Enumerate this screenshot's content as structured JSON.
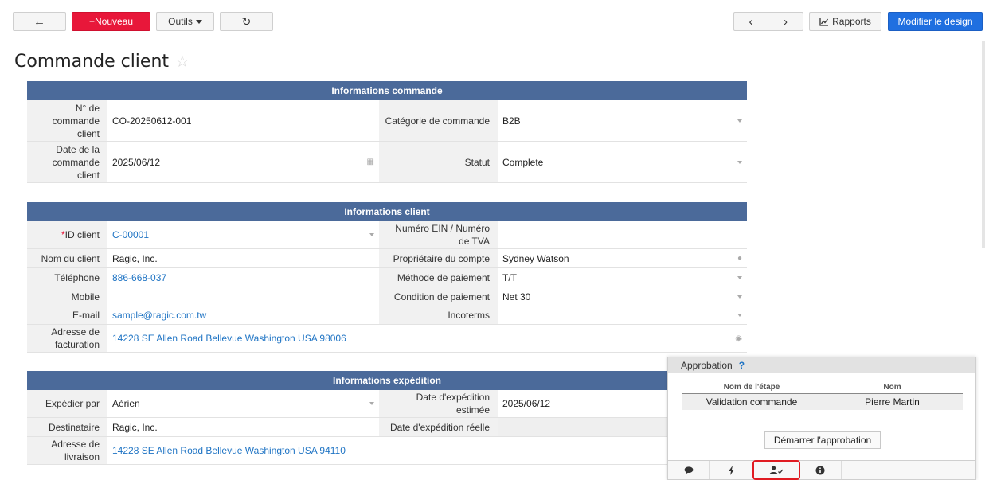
{
  "toolbar": {
    "back_icon": "arrow-left-icon",
    "new_label": "+Nouveau",
    "tools_label": "Outils",
    "refresh_icon": "refresh-icon",
    "prev_icon": "chevron-left-icon",
    "next_icon": "chevron-right-icon",
    "reports_label": "Rapports",
    "design_label": "Modifier le design"
  },
  "page": {
    "title": "Commande client"
  },
  "order": {
    "header": "Informations commande",
    "order_no_label": "N° de commande client",
    "order_no_value": "CO-20250612-001",
    "category_label": "Catégorie de commande",
    "category_value": "B2B",
    "date_label": "Date de la commande client",
    "date_value": "2025/06/12",
    "status_label": "Statut",
    "status_value": "Complete"
  },
  "client": {
    "header": "Informations client",
    "id_label": "ID client",
    "id_value": "C-00001",
    "ein_label": "Numéro EIN / Numéro de TVA",
    "ein_value": "",
    "name_label": "Nom du client",
    "name_value": "Ragic, Inc.",
    "owner_label": "Propriétaire du compte",
    "owner_value": "Sydney Watson",
    "phone_label": "Téléphone",
    "phone_value": "886-668-037",
    "payment_method_label": "Méthode de paiement",
    "payment_method_value": "T/T",
    "mobile_label": "Mobile",
    "mobile_value": "",
    "payment_term_label": "Condition de paiement",
    "payment_term_value": "Net 30",
    "email_label": "E-mail",
    "email_value": "sample@ragic.com.tw",
    "incoterms_label": "Incoterms",
    "incoterms_value": "",
    "billing_label": "Adresse de facturation",
    "billing_value": "14228 SE Allen Road Bellevue Washington USA 98006"
  },
  "shipping": {
    "header": "Informations expédition",
    "ship_by_label": "Expédier par",
    "ship_by_value": "Aérien",
    "est_date_label": "Date d'expédition estimée",
    "est_date_value": "2025/06/12",
    "recipient_label": "Destinataire",
    "recipient_value": "Ragic, Inc.",
    "actual_date_label": "Date d'expédition réelle",
    "actual_date_value": "",
    "delivery_label": "Adresse de livraison",
    "delivery_value": "14228 SE Allen Road Bellevue Washington USA 94110"
  },
  "approval": {
    "title": "Approbation",
    "help": "?",
    "col_step": "Nom de l'étape",
    "col_name": "Nom",
    "rows": [
      {
        "step": "Validation commande",
        "name": "Pierre Martin"
      }
    ],
    "start_label": "Démarrer l'approbation",
    "tabs": [
      "comment-icon",
      "lightning-icon",
      "approval-user-icon",
      "info-icon"
    ]
  },
  "colors": {
    "header": "#4b6a9a",
    "new": "#e8173a",
    "design": "#1f6fe0",
    "link": "#1f74c4",
    "highlight": "#e01b22"
  }
}
